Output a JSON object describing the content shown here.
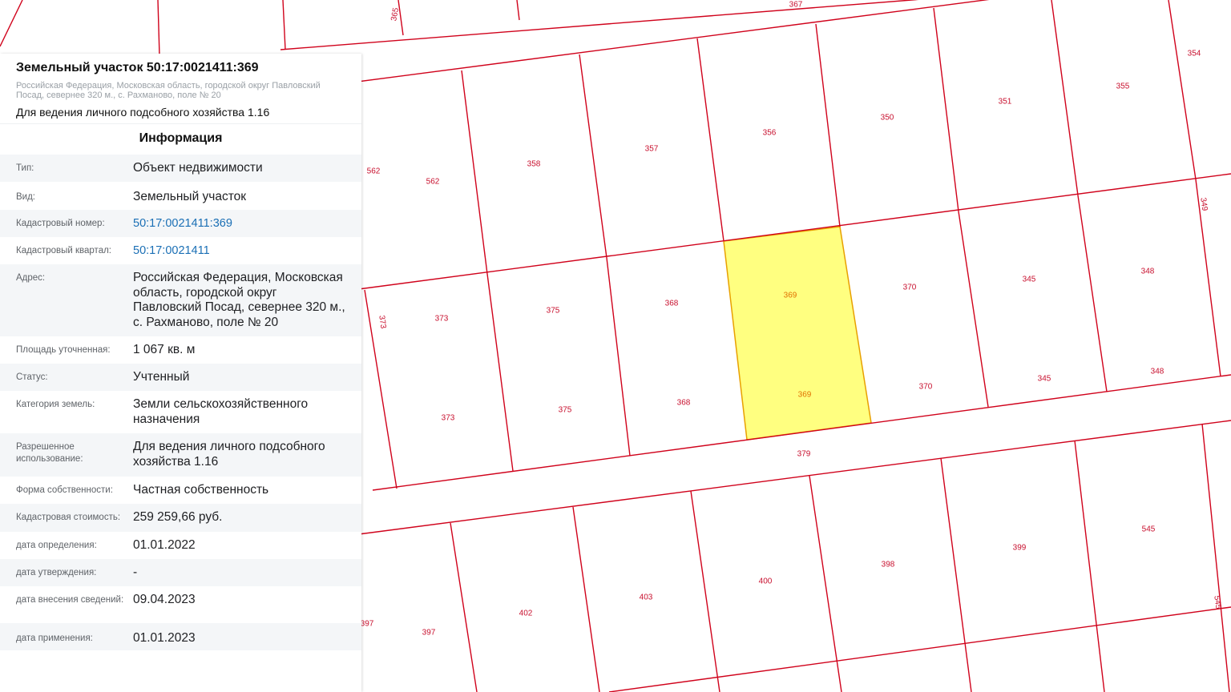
{
  "header": {
    "title": "Земельный участок 50:17:0021411:369",
    "address_small": "Российская Федерация, Московская область, городской округ Павловский Посад, севернее 320 м., с. Рахманово, поле № 20",
    "purpose": "Для ведения личного подсобного хозяйства 1.16"
  },
  "info": {
    "title": "Информация",
    "rows": [
      {
        "key": "Тип:",
        "value": "Объект недвижимости"
      },
      {
        "key": "Вид:",
        "value": "Земельный участок"
      },
      {
        "key": "Кадастровый номер:",
        "value": "50:17:0021411:369",
        "link": true
      },
      {
        "key": "Кадастровый квартал:",
        "value": "50:17:0021411",
        "link": true
      },
      {
        "key": "Адрес:",
        "value": "Российская Федерация, Московская область, городской округ Павловский Посад, севернее 320 м., с. Рахманово, поле № 20"
      },
      {
        "key": "Площадь уточненная:",
        "value": "1 067 кв. м"
      },
      {
        "key": "Статус:",
        "value": "Учтенный"
      },
      {
        "key": "Категория земель:",
        "value": "Земли сельскохозяйственного назначения"
      },
      {
        "key": "Разрешенное использование:",
        "value": "Для ведения личного подсобного хозяйства 1.16"
      },
      {
        "key": "Форма собственности:",
        "value": "Частная собственность"
      },
      {
        "key": "Кадастровая стоимость:",
        "value": "259 259,66 руб."
      },
      {
        "key": "дата определения:",
        "value": "01.01.2022"
      },
      {
        "key": "дата утверждения:",
        "value": "-"
      },
      {
        "key": "дата внесения сведений:",
        "value": "09.04.2023"
      },
      {
        "key": "дата применения:",
        "value": "01.01.2023"
      }
    ]
  },
  "map": {
    "line_color": "#d0021b",
    "highlight_fill": "#ffff80",
    "highlight_stroke": "#e8a000",
    "labels": [
      "365",
      "367",
      "354",
      "355",
      "351",
      "350",
      "356",
      "357",
      "358",
      "562",
      "562",
      "349",
      "370",
      "345",
      "348",
      "369",
      "369",
      "368",
      "375",
      "373",
      "373",
      "370",
      "345",
      "348",
      "368",
      "375",
      "373",
      "379",
      "545",
      "399",
      "398",
      "400",
      "403",
      "402",
      "397",
      "397",
      "545"
    ]
  }
}
